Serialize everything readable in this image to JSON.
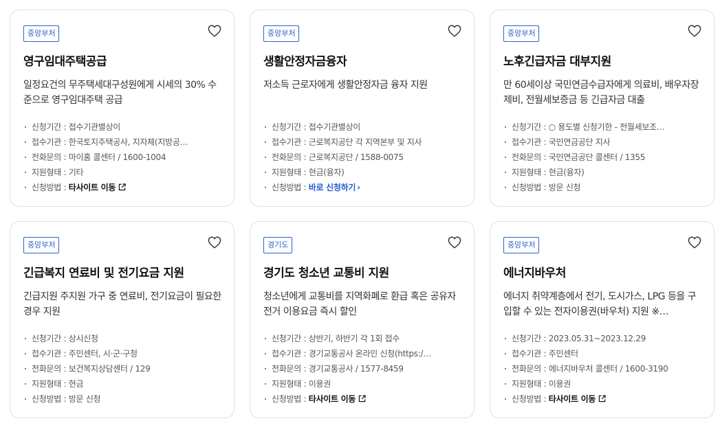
{
  "labels": {
    "period": "신청기간",
    "agency": "접수기관",
    "phone": "전화문의",
    "type": "지원형태",
    "method": "신청방법",
    "separator": " : "
  },
  "cards": [
    {
      "badge": "중앙부처",
      "title": "영구임대주택공급",
      "desc": "일정요건의 무주택세대구성원에게 시세의 30% 수준으로 영구임대주택 공급",
      "period": "접수기관별상이",
      "agency": "한국토지주택공사, 지자체(지방공…",
      "phone": "마이홈 콜센터 / 1600-1004",
      "type": "기타",
      "method": "타사이트 이동",
      "method_kind": "external",
      "heart_icon": "heart-outline-icon"
    },
    {
      "badge": "중앙부처",
      "title": "생활안정자금융자",
      "desc": "저소득 근로자에게 생활안정자금 융자 지원",
      "period": "접수기관별상이",
      "agency": "근로복지공단 각 지역본부 및 지사",
      "phone": "근로복지공단 / 1588-0075",
      "type": "현금(융자)",
      "method": "바로 신청하기",
      "method_kind": "apply",
      "heart_icon": "heart-outline-icon"
    },
    {
      "badge": "중앙부처",
      "title": "노후긴급자금 대부지원",
      "desc": "만 60세이상 국민연금수급자에게 의료비, 배우자장제비, 전월세보증금 등 긴급자금 대출",
      "period": "○ 용도별 신청기한 - 전월세보조…",
      "agency": "국민연금공단 지사",
      "phone": "국민연금공단 콜센터 / 1355",
      "type": "현금(융자)",
      "method": "방문 신청",
      "method_kind": "plain",
      "heart_icon": "heart-outline-icon"
    },
    {
      "badge": "중앙부처",
      "title": "긴급복지 연료비 및 전기요금 지원",
      "desc": "긴급지원 주지원 가구 중 연료비, 전기요금이 필요한 경우 지원",
      "period": "상시신청",
      "agency": "주민센터, 시·군·구청",
      "phone": "보건복지상담센터 / 129",
      "type": "현금",
      "method": "방문 신청",
      "method_kind": "plain",
      "heart_icon": "heart-outline-icon"
    },
    {
      "badge": "경기도",
      "title": "경기도 청소년 교통비 지원",
      "desc": "청소년에게 교통비를 지역화폐로 환급 혹은 공유자전거 이용요금 즉시 할인",
      "period": "상반기, 하반기 각 1회 접수",
      "agency": "경기교통공사 온라인 신청(https:/…",
      "phone": "경기교통공사 / 1577-8459",
      "type": "이용권",
      "method": "타사이트 이동",
      "method_kind": "external",
      "heart_icon": "heart-outline-icon"
    },
    {
      "badge": "중앙부처",
      "title": "에너지바우처",
      "desc": "에너지 취약계층에서 전기, 도시가스, LPG 등을 구입할 수 있는 전자이용권(바우처) 지원 ※…",
      "period": "2023.05.31~2023.12.29",
      "agency": "주민센터",
      "phone": "에너지바우처 콜센터 / 1600-3190",
      "type": "이용권",
      "method": "타사이트 이동",
      "method_kind": "external",
      "heart_icon": "heart-outline-icon"
    }
  ],
  "colors": {
    "accent": "#2d63c8",
    "apply_link": "#1f5bd1",
    "border": "#dcdfe4"
  }
}
